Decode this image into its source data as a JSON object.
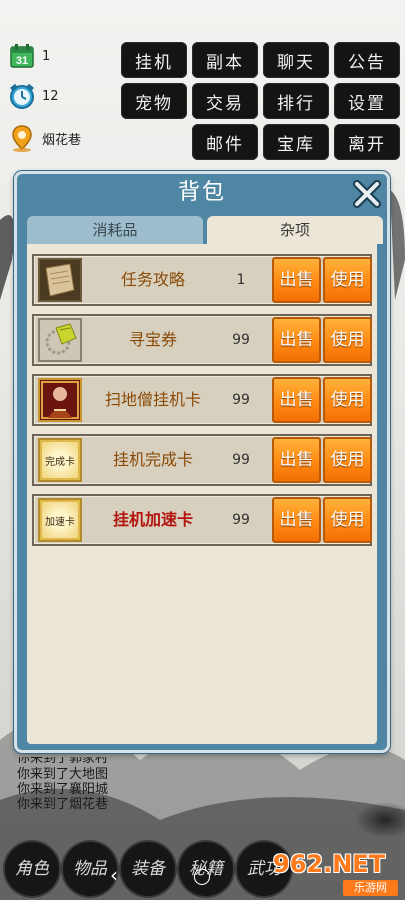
{
  "status": {
    "day_value": "1",
    "time_value": "12",
    "location": "烟花巷"
  },
  "menu": [
    "挂机",
    "副本",
    "聊天",
    "公告",
    "宠物",
    "交易",
    "排行",
    "设置",
    "邮件",
    "宝库",
    "离开"
  ],
  "panel": {
    "title": "背包",
    "tabs": [
      "消耗品",
      "杂项"
    ],
    "active_tab": "杂项",
    "sell_label": "出售",
    "use_label": "使用",
    "items": [
      {
        "name": "任务攻略",
        "qty": "1",
        "icon": "scroll-icon",
        "name_color": "#8a4a08"
      },
      {
        "name": "寻宝券",
        "qty": "99",
        "icon": "treasure-ticket-icon",
        "name_color": "#8a4a08"
      },
      {
        "name": "扫地僧挂机卡",
        "qty": "99",
        "icon": "monk-card-icon",
        "name_color": "#8a4a08"
      },
      {
        "name": "挂机完成卡",
        "qty": "99",
        "icon": "complete-card-icon",
        "icon_text": "完成卡",
        "name_color": "#8a4a08"
      },
      {
        "name": "挂机加速卡",
        "qty": "99",
        "icon": "speed-card-icon",
        "icon_text": "加速卡",
        "name_color": "#b3140e"
      }
    ]
  },
  "chat": [
    "你来到了郭家村",
    "你来到了大地图",
    "你来到了襄阳城",
    "你来到了烟花巷"
  ],
  "bottom_nav": [
    "角色",
    "物品",
    "装备",
    "秘籍",
    "武功"
  ],
  "watermark": {
    "brand": "962.NET",
    "sub": "乐游网"
  },
  "colors": {
    "panel": "#4f86a4",
    "button": "#ff8a12",
    "tab_active": "#ece6d8",
    "tab_inactive": "#9ebdcc"
  }
}
